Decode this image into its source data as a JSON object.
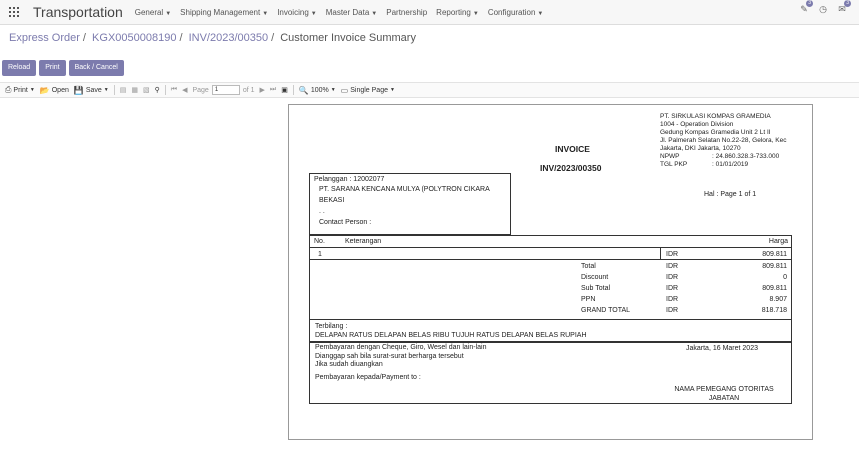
{
  "nav": {
    "brand": "Transportation",
    "menu": [
      "General",
      "Shipping Management",
      "Invoicing",
      "Master Data",
      "Partnership",
      "Reporting",
      "Configuration"
    ],
    "badges": {
      "activities": "3",
      "messages": "3"
    }
  },
  "breadcrumb": [
    "Express Order",
    "KGX0050008190",
    "INV/2023/00350",
    "Customer Invoice Summary"
  ],
  "buttons": {
    "reload": "Reload",
    "print": "Print",
    "back": "Back / Cancel"
  },
  "toolbar": {
    "print": "Print",
    "open": "Open",
    "save": "Save",
    "page_label": "Page",
    "page_value": "1",
    "of_label": "of 1",
    "zoom": "100%",
    "view_mode": "Single Page"
  },
  "invoice": {
    "company": {
      "name": "PT. SIRKULASI KOMPAS GRAMEDIA",
      "division": "1004 - Operation Division",
      "address1": "Gedung Kompas Gramedia Unit 2 Lt II",
      "address2": "Jl. Palmerah Selatan No.22-28, Gelora, Kec",
      "address3": "Jakarta, DKI Jakarta, 10270",
      "npwp_label": "NPWP",
      "npwp": ": 24.860.328.3-733.000",
      "tglpkp_label": "TGL PKP",
      "tglpkp": ": 01/01/2019"
    },
    "title": "INVOICE",
    "number": "INV/2023/00350",
    "customer": {
      "pelanggan": "Pelanggan     : 12002077",
      "name_line1": "PT. SARANA KENCANA MULYA (POLYTRON CIKARA",
      "name_line2": "BEKASI",
      "address": ". .",
      "contact": "Contact Person   :"
    },
    "page_info": "Hal    : Page 1 of 1",
    "table": {
      "col_no": "No.",
      "col_desc": "Keterangan",
      "col_price": "Harga",
      "line": {
        "no": "1",
        "currency": "IDR",
        "amount": "809.811"
      },
      "totals": [
        {
          "label": "Total",
          "currency": "IDR",
          "amount": "809.811"
        },
        {
          "label": "Discount",
          "currency": "IDR",
          "amount": "0"
        },
        {
          "label": "Sub Total",
          "currency": "IDR",
          "amount": "809.811"
        },
        {
          "label": "PPN",
          "currency": "IDR",
          "amount": "8.907"
        },
        {
          "label": "GRAND TOTAL",
          "currency": "IDR",
          "amount": "818.718"
        }
      ]
    },
    "terbilang_label": "Terbilang :",
    "terbilang": "DELAPAN RATUS DELAPAN BELAS RIBU TUJUH RATUS DELAPAN BELAS RUPIAH",
    "payment": {
      "line1": "Pembayaran dengan Cheque, Giro, Wesel dan lain-lain",
      "line2": "Dianggap sah bila surat-surat berharga tersebut",
      "line3": "Jika sudah diuangkan",
      "line4": "Pembayaran kepada/Payment to    :",
      "date": "Jakarta, 16 Maret 2023",
      "signer1": "NAMA PEMEGANG OTORITAS",
      "signer2": "JABATAN"
    }
  }
}
